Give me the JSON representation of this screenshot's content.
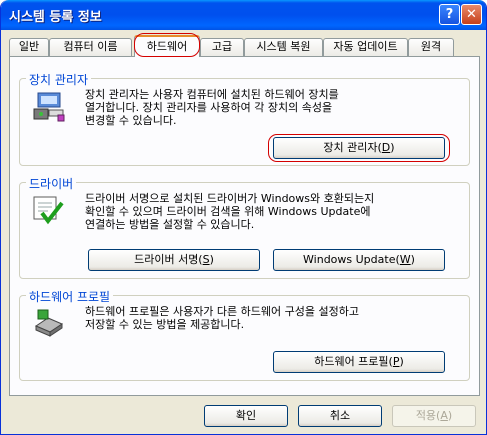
{
  "window": {
    "title": "시스템 등록 정보"
  },
  "titlebar": {
    "help_glyph": "?",
    "close_glyph": "✕"
  },
  "tabs": [
    {
      "label": "일반"
    },
    {
      "label": "컴퓨터 이름"
    },
    {
      "label": "하드웨어"
    },
    {
      "label": "고급"
    },
    {
      "label": "시스템 복원"
    },
    {
      "label": "자동 업데이트"
    },
    {
      "label": "원격"
    }
  ],
  "active_tab": "하드웨어",
  "device_manager": {
    "title": "장치 관리자",
    "line1": "장치 관리자는 사용자 컴퓨터에 설치된 하드웨어 장치를",
    "line2": "열거합니다. 장치 관리자를 사용하여 각 장치의 속성을",
    "line3": "변경할 수 있습니다.",
    "button": "장치 관리자(",
    "button_key": "D",
    "button_end": ")"
  },
  "driver": {
    "title": "드라이버",
    "line1": "드라이버 서명으로 설치된 드라이버가 Windows와 호환되는지",
    "line2": "확인할 수 있으며 드라이버 검색을 위해 Windows Update에",
    "line3": "연결하는 방법을 설정할 수 있습니다.",
    "sign_button": "드라이버 서명(",
    "sign_key": "S",
    "sign_end": ")",
    "update_button": "Windows Update(",
    "update_key": "W",
    "update_end": ")"
  },
  "profiles": {
    "title": "하드웨어 프로필",
    "line1": "하드웨어 프로필은 사용자가 다른 하드웨어 구성을 설정하고",
    "line2": "저장할 수 있는 방법을 제공합니다.",
    "button": "하드웨어 프로필(",
    "button_key": "P",
    "button_end": ")"
  },
  "footer": {
    "ok": "확인",
    "cancel": "취소",
    "apply": "적용(",
    "apply_key": "A",
    "apply_end": ")"
  },
  "colors": {
    "titlebar": "#0053ee",
    "group_title": "#0046d5",
    "highlight_ring": "#d40000",
    "dialog_bg": "#ece9d8"
  }
}
